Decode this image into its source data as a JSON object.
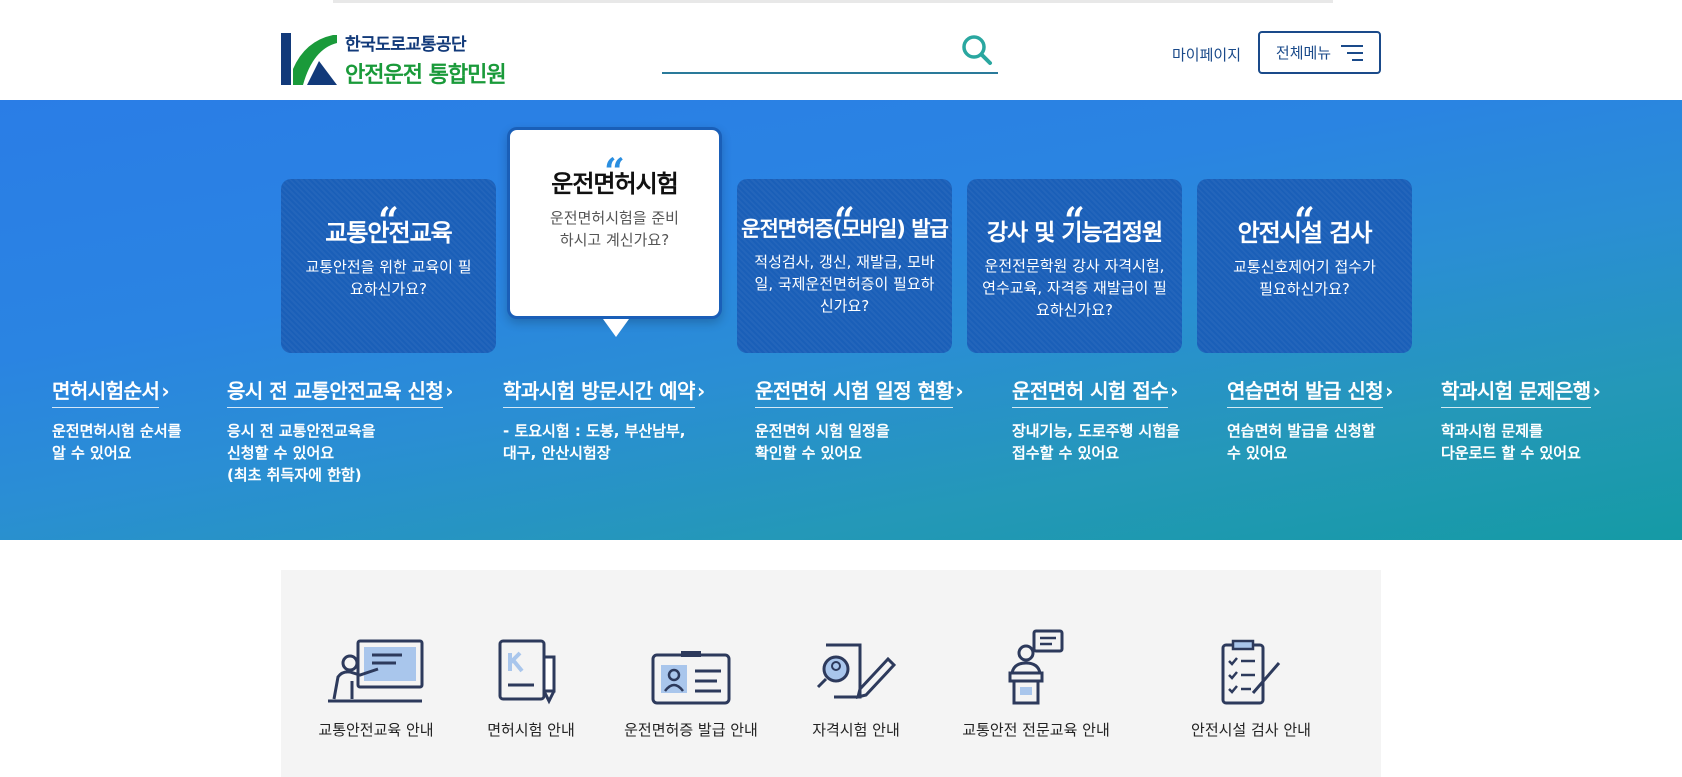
{
  "header": {
    "org_name": "한국도로교통공단",
    "site_name": "안전운전 통합민원",
    "search_placeholder": "",
    "mypage_label": "마이페이지",
    "all_menu_label": "전체메뉴"
  },
  "colors": {
    "brand_blue": "#1a4a8a",
    "brand_green": "#1a9a3a",
    "card_blue": "#1a5fb8"
  },
  "cards": [
    {
      "quote": "“",
      "title": "교통안전교육",
      "desc": "교통안전을 위한 교육이 필요하신가요?"
    },
    {
      "quote": "“",
      "title": "운전면허시험",
      "desc": "운전면허시험을 준비하시고 계신가요?"
    },
    {
      "quote": "“",
      "title": "운전면허증(모바일) 발급",
      "desc": "적성검사, 갱신, 재발급, 모바일, 국제운전면허증이 필요하신가요?"
    },
    {
      "quote": "“",
      "title": "강사 및 기능검정원",
      "desc": "운전전문학원 강사 자격시험, 연수교육, 자격증 재발급이 필요하신가요?"
    },
    {
      "quote": "“",
      "title": "안전시설 검사",
      "desc": "교통신호제어기 접수가 필요하신가요?"
    }
  ],
  "services": [
    {
      "title": "면허시험순서",
      "desc": "운전면허시험 순서를\n알 수 있어요"
    },
    {
      "title": "응시 전 교통안전교육 신청",
      "desc": "응시 전 교통안전교육을\n신청할 수 있어요\n(최초 취득자에 한함)"
    },
    {
      "title": "학과시험 방문시간 예약",
      "desc": "- 토요시험 : 도봉, 부산남부,\n   대구, 안산시험장"
    },
    {
      "title": "운전면허 시험 일정 현황",
      "desc": "운전면허 시험 일정을\n확인할 수 있어요"
    },
    {
      "title": "운전면허 시험 접수",
      "desc": "장내기능, 도로주행 시험을\n접수할 수 있어요"
    },
    {
      "title": "연습면허 발급 신청",
      "desc": "연습면허 발급을 신청할\n수 있어요"
    },
    {
      "title": "학과시험 문제은행",
      "desc": "학과시험 문제를\n다운로드 할 수 있어요"
    }
  ],
  "quick_menu": [
    {
      "label": "교통안전교육 안내",
      "icon": "lecture-icon"
    },
    {
      "label": "면허시험 안내",
      "icon": "license-book-icon"
    },
    {
      "label": "운전면허증 발급 안내",
      "icon": "id-card-icon"
    },
    {
      "label": "자격시험 안내",
      "icon": "exam-pencil-icon"
    },
    {
      "label": "교통안전 전문교육 안내",
      "icon": "speaker-podium-icon"
    },
    {
      "label": "안전시설 검사 안내",
      "icon": "checklist-icon"
    }
  ]
}
